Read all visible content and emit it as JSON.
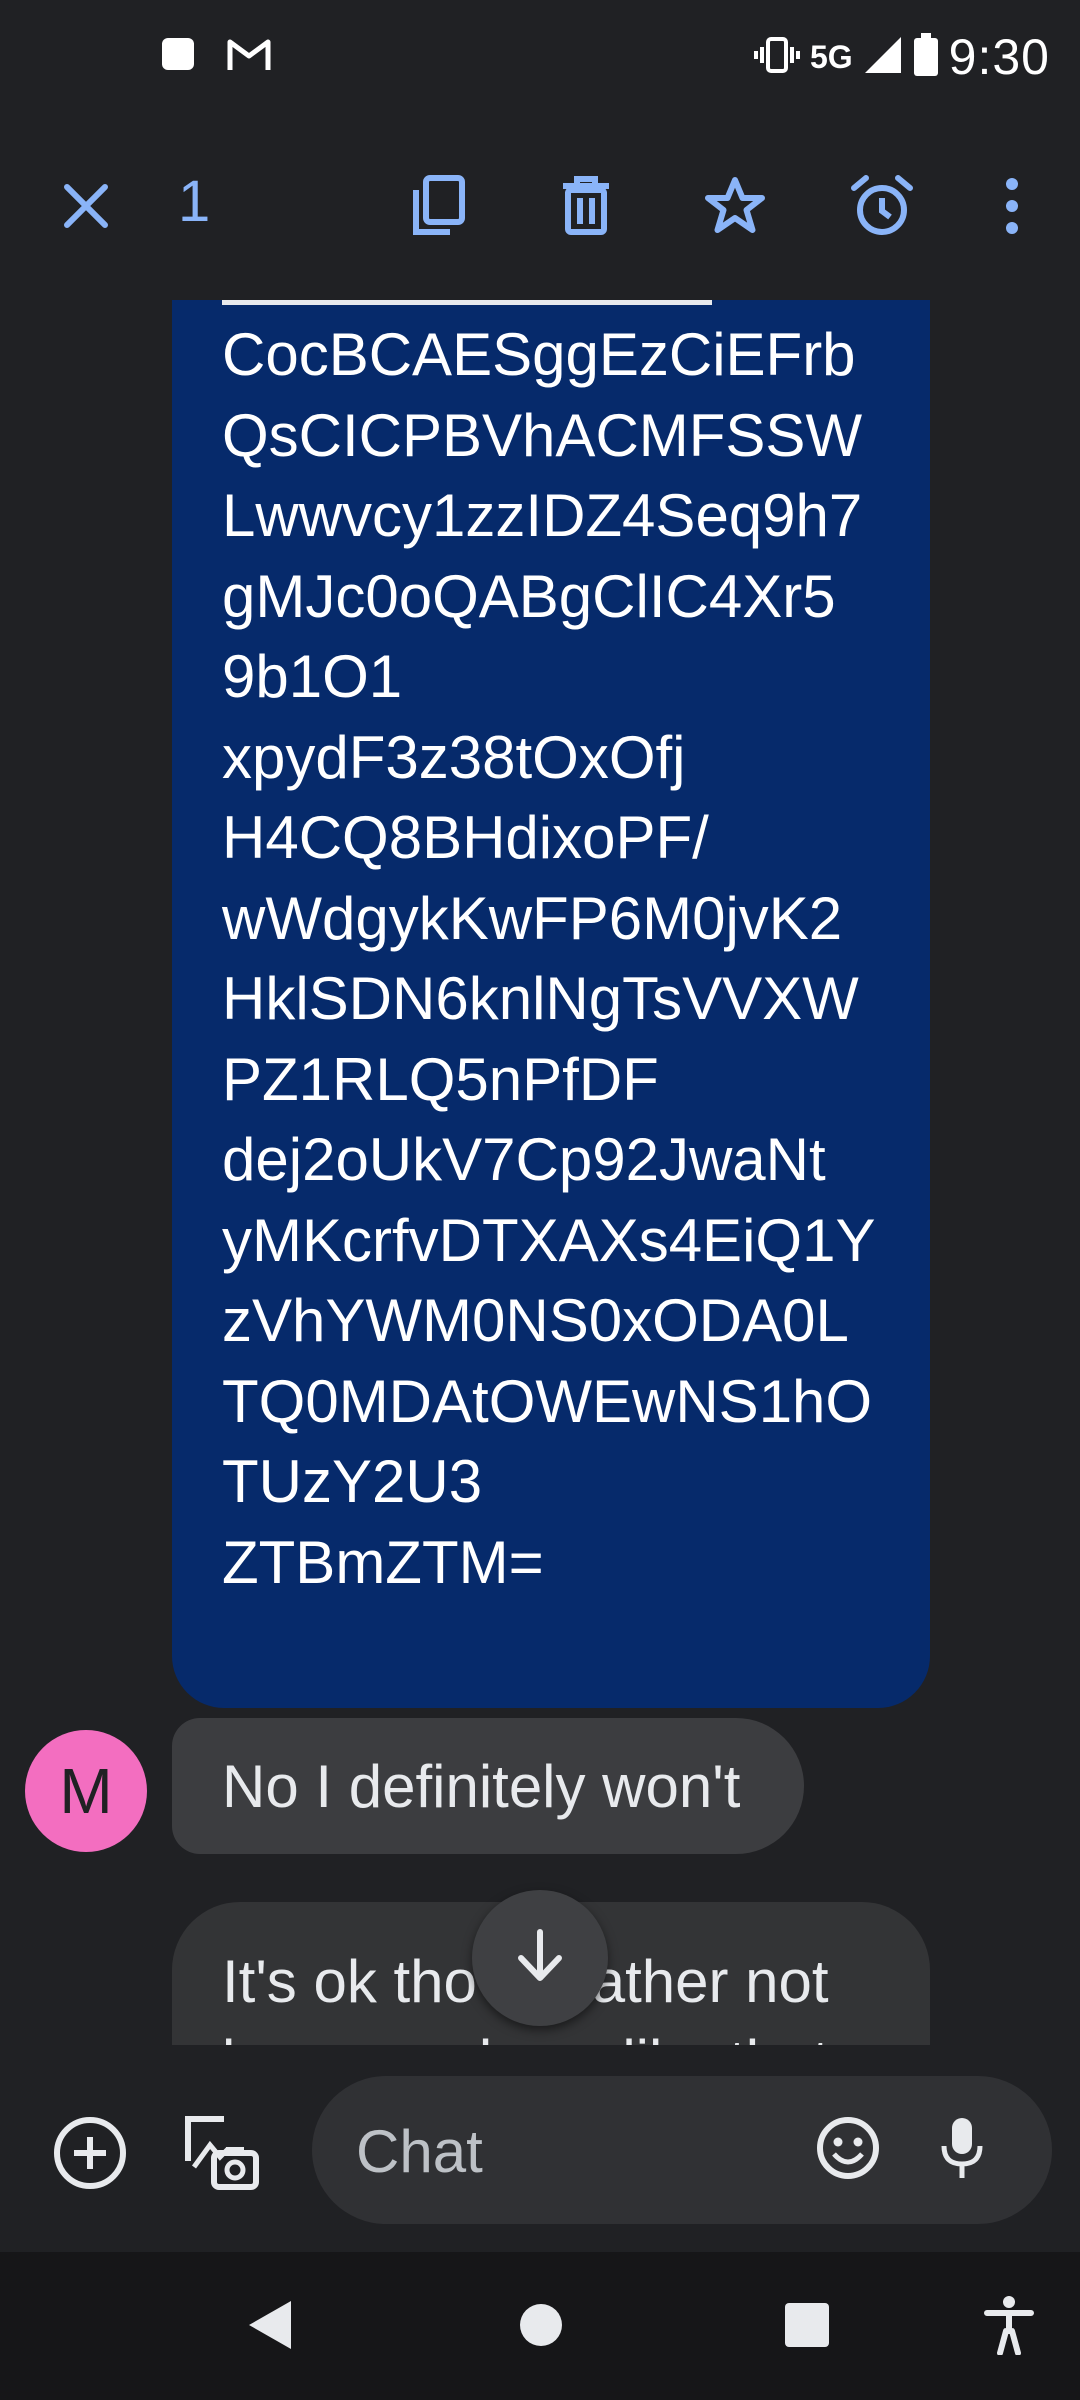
{
  "status_bar": {
    "time": "9:30",
    "network": "5G",
    "icons": [
      "app-square-icon",
      "gmail-icon",
      "vibrate-icon",
      "signal-icon",
      "battery-icon"
    ]
  },
  "action_bar": {
    "selected_count": "1",
    "icons": [
      "close-icon",
      "copy-icon",
      "delete-icon",
      "star-icon",
      "alarm-icon",
      "more-vert-icon"
    ],
    "accent": "#8ab4f8"
  },
  "messages": {
    "sent": {
      "text": "CocBCAESggEzCiEFrb\nQsCICPBVhACMFSSW\nLwwvcy1zzIDZ4Seq9h7\ngMJc0oQABgClIC4Xr5\n9b1O1\nxpydF3z38tOxOfj\nH4CQ8BHdixoPF/\nwWdgykKwFP6M0jvK2\nHklSDN6knlNgTsVVXW\nPZ1RLQ5nPfDF\ndej2oUkV7Cp92JwaNt\nyMKcrfvDTXAXs4EiQ1Y\nzVhYWM0NS0xODA0L\nTQ0MDAtOWEwNS1hO\nTUzY2U3\nZTBmZTM=",
      "bubble_color": "#062a6b"
    },
    "received": [
      {
        "avatar_letter": "M",
        "avatar_color": "#f36ec0",
        "text": "No I definitely won't"
      },
      {
        "text": "It's ok tho I'd rather not be around you like that"
      }
    ]
  },
  "compose": {
    "placeholder": "Chat",
    "icons": [
      "add-circle-icon",
      "gallery-camera-icon",
      "emoji-icon",
      "mic-icon"
    ]
  },
  "nav_bar": {
    "icons": [
      "back-icon",
      "home-icon",
      "recents-icon",
      "accessibility-icon"
    ]
  }
}
